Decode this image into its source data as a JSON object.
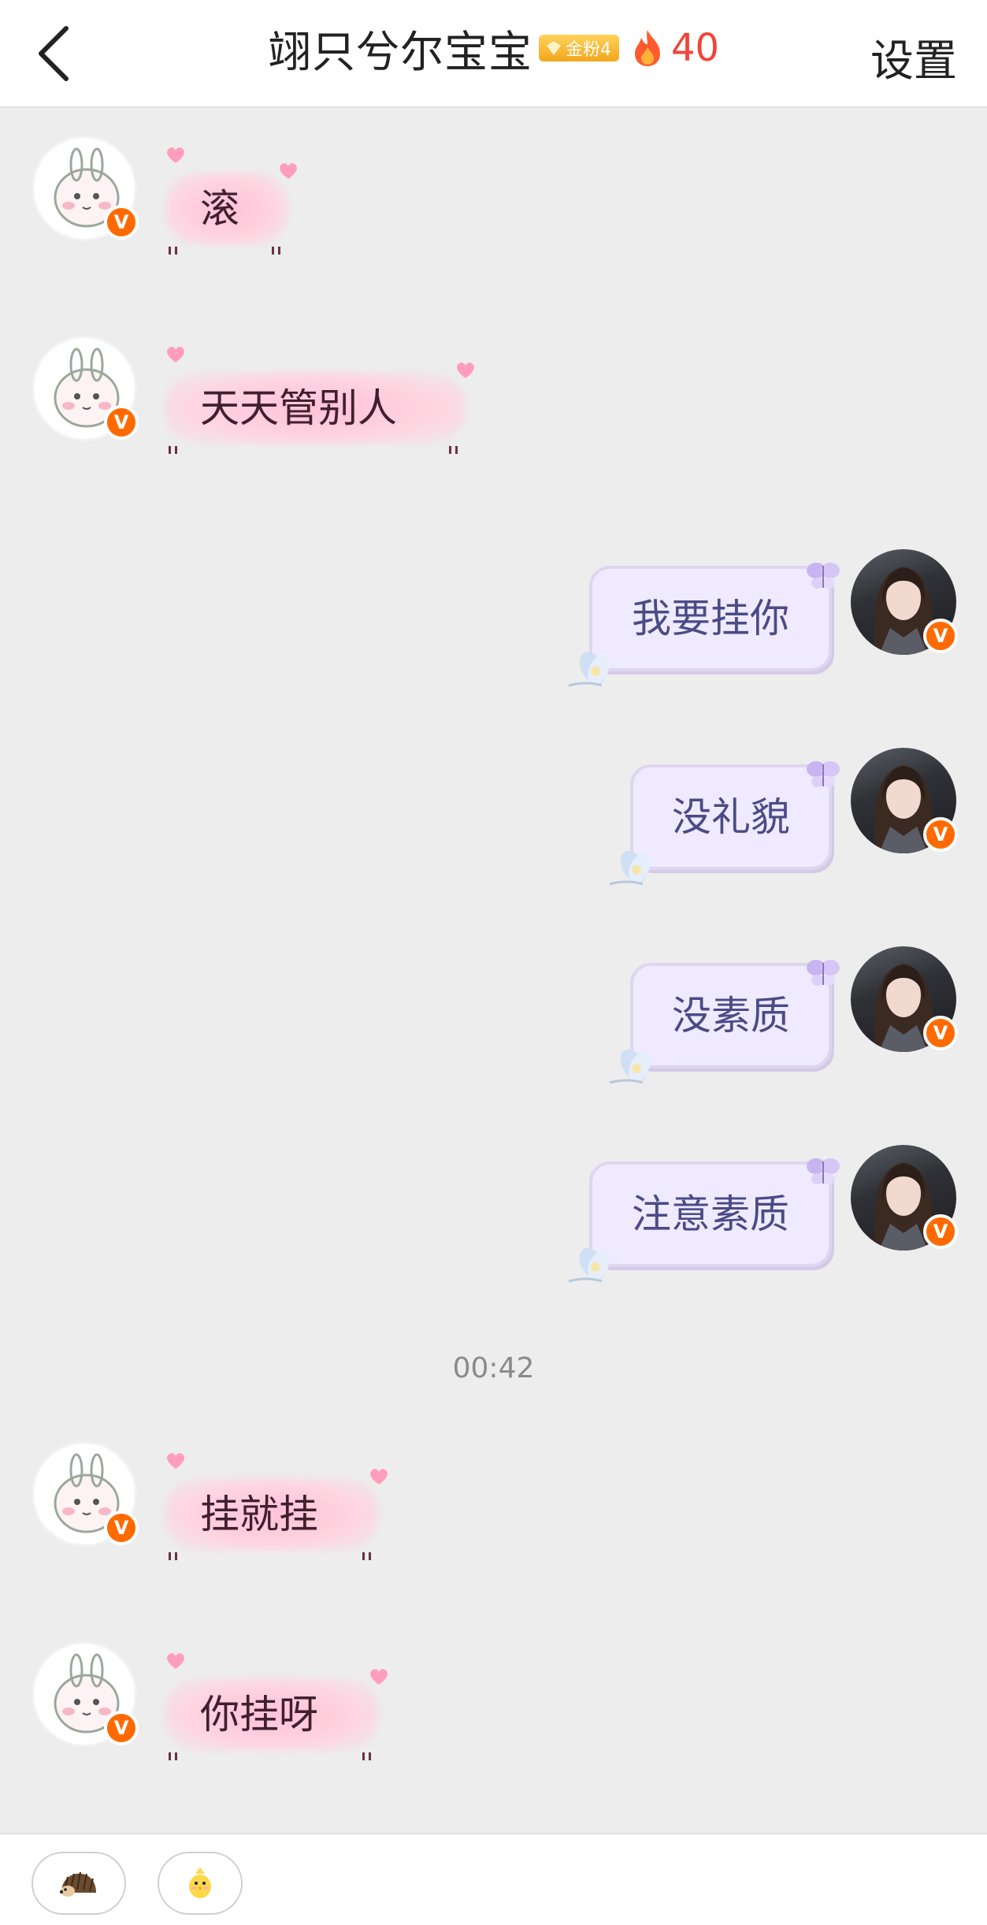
{
  "header": {
    "title": "翊只兮尔宝宝",
    "badge_label": "金粉4",
    "streak_count": "40",
    "settings_label": "设置"
  },
  "messages": [
    {
      "side": "left",
      "text": "滚"
    },
    {
      "side": "left",
      "text": "天天管别人"
    },
    {
      "side": "right",
      "text": "我要挂你"
    },
    {
      "side": "right",
      "text": "没礼貌"
    },
    {
      "side": "right",
      "text": "没素质"
    },
    {
      "side": "right",
      "text": "注意素质"
    },
    {
      "side": "left",
      "text": "挂就挂"
    },
    {
      "side": "left",
      "text": "你挂呀"
    }
  ],
  "timestamp": "00:42",
  "avatar_badge": "V",
  "bottom_bar": {
    "items": [
      {
        "icon": "hedgehog-icon"
      },
      {
        "icon": "chick-icon"
      }
    ]
  },
  "colors": {
    "accent_red": "#f0453a",
    "verified_orange": "#ff6a00",
    "gold_badge": "#f4a51c"
  }
}
